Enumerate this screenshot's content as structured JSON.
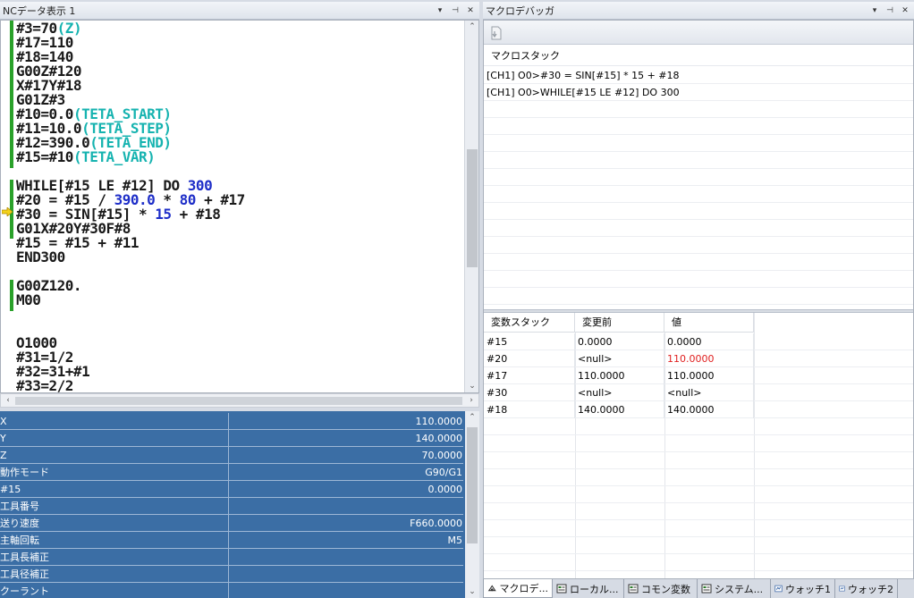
{
  "left_panel": {
    "title": "NCデータ表示 1",
    "buttons": {
      "dropdown": "▾",
      "pin": "⊣",
      "close": "✕"
    },
    "code_lines": [
      [
        [
          "#3=70",
          "k"
        ],
        [
          "(Z)",
          "c"
        ]
      ],
      [
        [
          "#17=110",
          "k"
        ]
      ],
      [
        [
          "#18=140",
          "k"
        ]
      ],
      [
        [
          "G00Z#120",
          "k"
        ]
      ],
      [
        [
          "X#17Y#18",
          "k"
        ]
      ],
      [
        [
          "G01Z#3",
          "k"
        ]
      ],
      [
        [
          "#10=0.0",
          "k"
        ],
        [
          "(TETA_START)",
          "c"
        ]
      ],
      [
        [
          "#11=10.0",
          "k"
        ],
        [
          "(TETA_STEP)",
          "c"
        ]
      ],
      [
        [
          "#12=390.0",
          "k"
        ],
        [
          "(TETA_END)",
          "c"
        ]
      ],
      [
        [
          "#15=#10",
          "k"
        ],
        [
          "(TETA_VAR)",
          "c"
        ]
      ],
      [
        [
          "",
          "k"
        ]
      ],
      [
        [
          "WHILE[#15 LE #12] DO ",
          "k"
        ],
        [
          "300",
          "n"
        ]
      ],
      [
        [
          "#20 = #15 / ",
          "k"
        ],
        [
          "390.0",
          "n"
        ],
        [
          " * ",
          "k"
        ],
        [
          "80",
          "n"
        ],
        [
          " + #17",
          "k"
        ]
      ],
      [
        [
          "#30 = SIN[#15] * ",
          "k"
        ],
        [
          "15",
          "n"
        ],
        [
          " + #18",
          "k"
        ]
      ],
      [
        [
          "G01X#20Y#30F#8",
          "k"
        ]
      ],
      [
        [
          "#15 = #15 + #11",
          "k"
        ]
      ],
      [
        [
          "END300",
          "k"
        ]
      ],
      [
        [
          "",
          "k"
        ]
      ],
      [
        [
          "G00Z120.",
          "k"
        ]
      ],
      [
        [
          "M00",
          "k"
        ]
      ],
      [
        [
          "",
          "k"
        ]
      ],
      [
        [
          "",
          "k"
        ]
      ],
      [
        [
          "O1000",
          "k"
        ]
      ],
      [
        [
          "#31=1/2",
          "k"
        ]
      ],
      [
        [
          "#32=31+#1",
          "k"
        ]
      ],
      [
        [
          "#33=2/2",
          "k"
        ]
      ]
    ],
    "properties": [
      {
        "name": "X",
        "value": "110.0000"
      },
      {
        "name": "Y",
        "value": "140.0000"
      },
      {
        "name": "Z",
        "value": "70.0000"
      },
      {
        "name": "動作モード",
        "value": "G90/G1"
      },
      {
        "name": "#15",
        "value": "0.0000"
      },
      {
        "name": "工具番号",
        "value": ""
      },
      {
        "name": "送り速度",
        "value": "F660.0000"
      },
      {
        "name": "主軸回転",
        "value": "M5"
      },
      {
        "name": "工具長補正",
        "value": ""
      },
      {
        "name": "工具径補正",
        "value": ""
      },
      {
        "name": "クーラント",
        "value": ""
      }
    ]
  },
  "right_panel": {
    "title": "マクロデバッガ",
    "buttons": {
      "dropdown": "▾",
      "pin": "⊣",
      "close": "✕"
    },
    "macro_stack_label": "マクロスタック",
    "macro_stack": [
      "[CH1] O0>#30 = SIN[#15] * 15 + #18",
      "[CH1] O0>WHILE[#15 LE #12] DO 300"
    ],
    "var_columns": [
      "変数スタック",
      "変更前",
      "値"
    ],
    "var_rows": [
      {
        "name": "#15",
        "before": "0.0000",
        "value": "0.0000",
        "changed": false
      },
      {
        "name": "#20",
        "before": "<null>",
        "value": "110.0000",
        "changed": true
      },
      {
        "name": "#17",
        "before": "110.0000",
        "value": "110.0000",
        "changed": false
      },
      {
        "name": "#30",
        "before": "<null>",
        "value": "<null>",
        "changed": false
      },
      {
        "name": "#18",
        "before": "140.0000",
        "value": "140.0000",
        "changed": false
      }
    ],
    "tabs": [
      {
        "label": "マクロデ...",
        "icon": "debugger-icon",
        "active": true
      },
      {
        "label": "ローカル...",
        "icon": "local-var-icon",
        "active": false
      },
      {
        "label": "コモン変数",
        "icon": "common-var-icon",
        "active": false
      },
      {
        "label": "システム...",
        "icon": "system-var-icon",
        "active": false
      },
      {
        "label": "ウォッチ1",
        "icon": "watch-icon",
        "active": false
      },
      {
        "label": "ウォッチ2",
        "icon": "watch-icon",
        "active": false
      }
    ]
  },
  "colors": {
    "keyword": "#1a1a1a",
    "number": "#1e2ec8",
    "comment": "#16b3b0",
    "changed_value": "#e02020",
    "property_bg": "#3b6ea5"
  }
}
